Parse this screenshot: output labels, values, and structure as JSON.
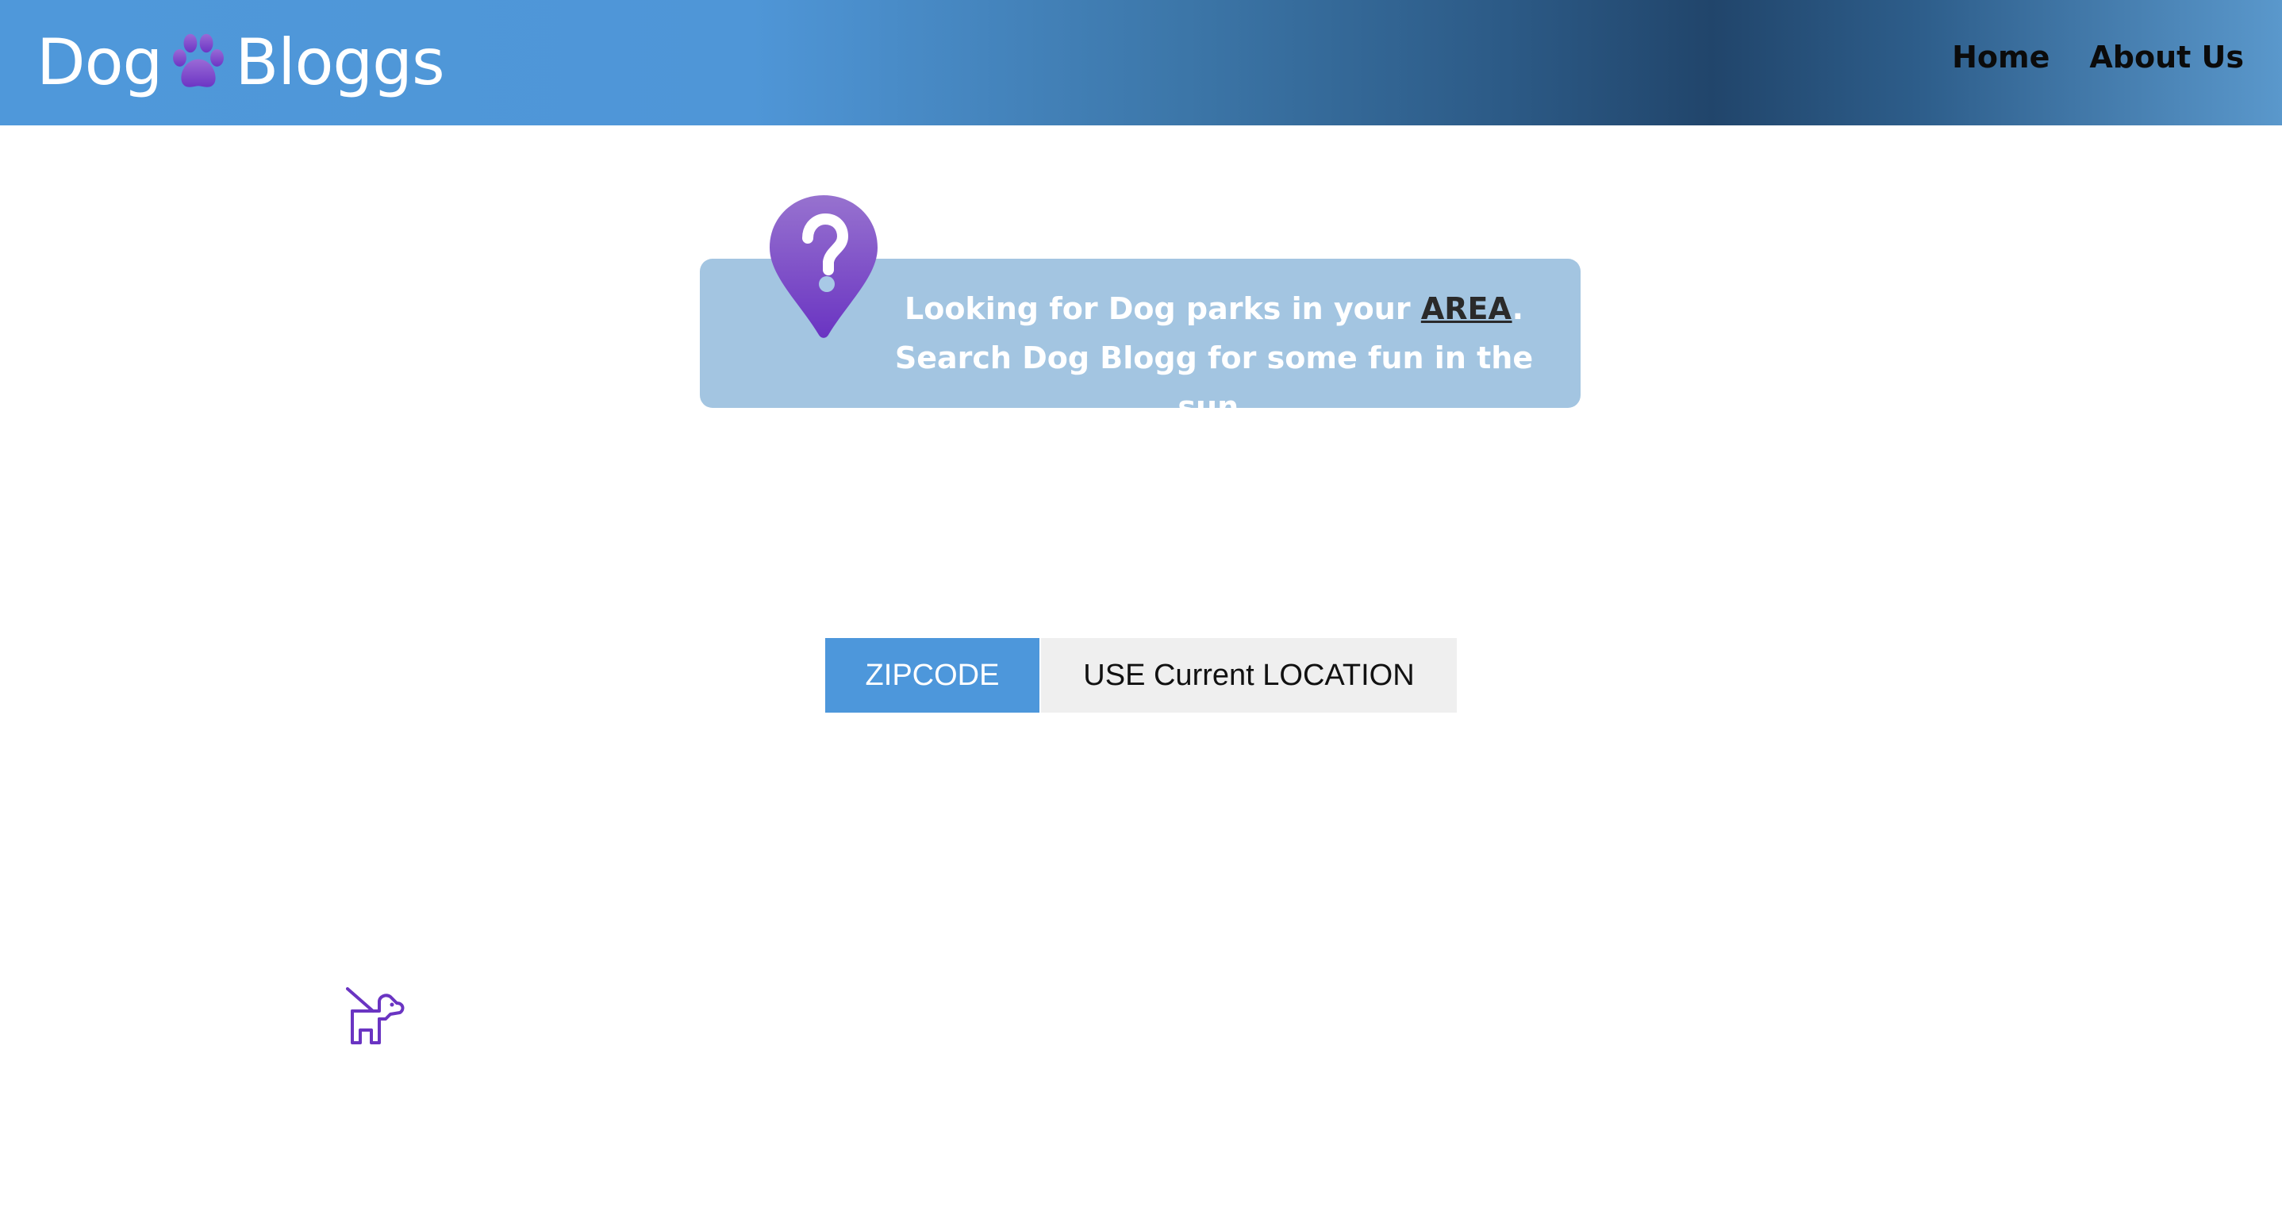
{
  "header": {
    "logo_left": "Dog",
    "logo_right": "Bloggs",
    "nav": [
      {
        "label": "Home"
      },
      {
        "label": "About Us"
      }
    ]
  },
  "info": {
    "text_before": "Looking for Dog parks in your ",
    "link_text": "AREA",
    "text_after": ". Search Dog Blogg for some fun in the sun."
  },
  "search_toggle": {
    "zipcode_label": "ZIPCODE",
    "location_label": "USE Current LOCATION"
  },
  "icons": {
    "paw": "paw-icon",
    "pin": "map-pin-question-icon",
    "dog": "dog-leash-icon"
  },
  "colors": {
    "header_blue": "#4f98da",
    "header_dark": "#21456b",
    "accent_purple": "#7b3fc7",
    "info_box": "#a3c5e1",
    "zip_button": "#4d97db",
    "location_button": "#efefef"
  }
}
